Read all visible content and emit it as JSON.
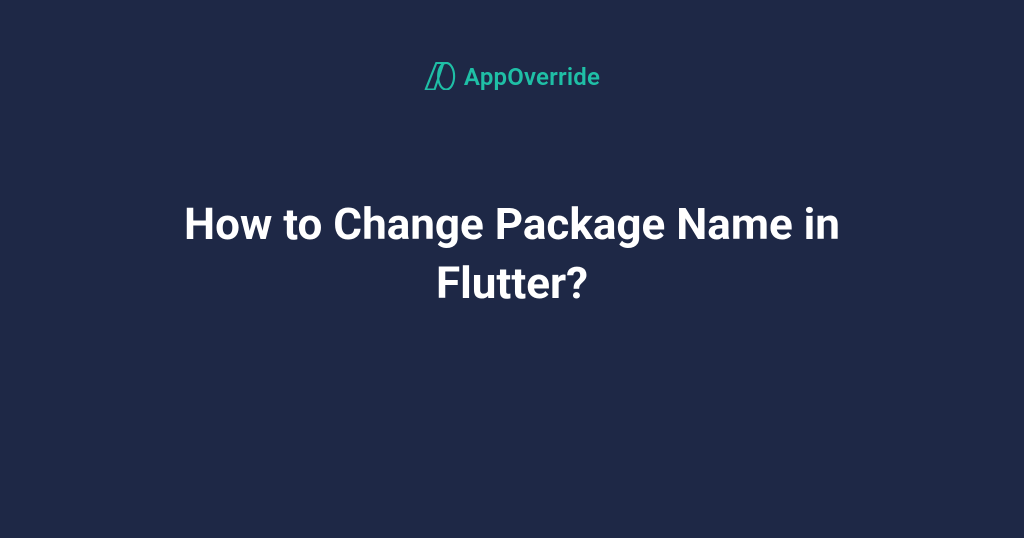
{
  "brand": {
    "name": "AppOverride",
    "accent_color": "#1fbfa6"
  },
  "background_color": "#1e2846",
  "title": "How to Change Package Name in Flutter?"
}
